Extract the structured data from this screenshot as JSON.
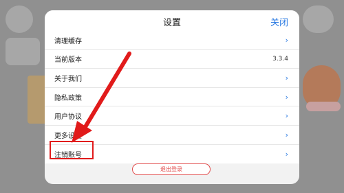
{
  "modal": {
    "title": "设置",
    "close_label": "关闭"
  },
  "settings": {
    "items": [
      {
        "label": "清理缓存",
        "value": "",
        "chevron": true
      },
      {
        "label": "当前版本",
        "value": "3.3.4",
        "chevron": false
      },
      {
        "label": "关于我们",
        "value": "",
        "chevron": true
      },
      {
        "label": "隐私政策",
        "value": "",
        "chevron": true
      },
      {
        "label": "用户协议",
        "value": "",
        "chevron": true
      },
      {
        "label": "更多设置",
        "value": "",
        "chevron": true
      },
      {
        "label": "注销账号",
        "value": "",
        "chevron": true
      }
    ]
  },
  "logout_label": "退出登录",
  "colors": {
    "accent": "#2a7ae2",
    "danger": "#e14b4b",
    "annotation": "#e11b1b"
  }
}
